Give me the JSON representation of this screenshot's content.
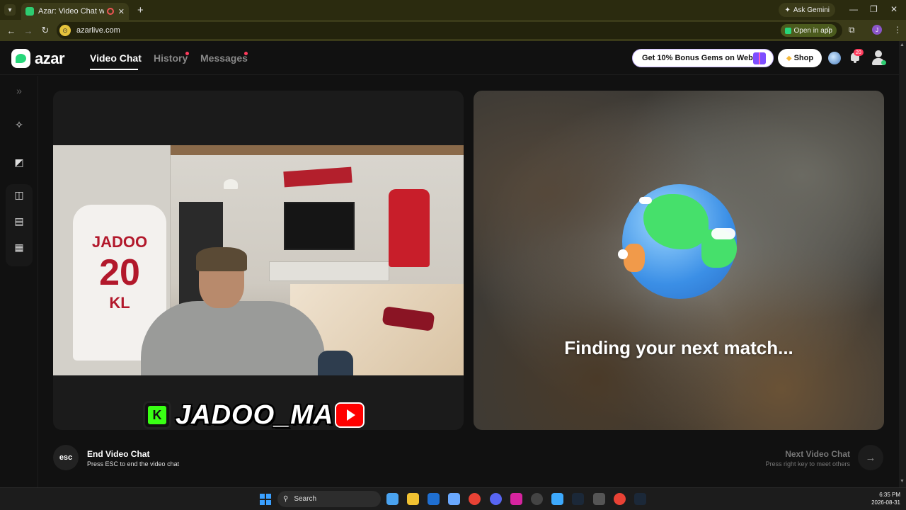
{
  "browser": {
    "tab_title": "Azar: Video Chat with New",
    "ask_gemini": "Ask Gemini",
    "url": "azarlive.com",
    "open_in_app": "Open in app",
    "profile_initial": "J"
  },
  "header": {
    "logo": "azar",
    "nav": [
      {
        "label": "Video Chat",
        "active": true
      },
      {
        "label": "History",
        "dot": true
      },
      {
        "label": "Messages",
        "dot": true
      }
    ],
    "bonus_label": "Get 10% Bonus Gems on Web!",
    "shop_label": "Shop",
    "notifications_count": "20"
  },
  "left_panel": {
    "shirt_name": "JADOO",
    "shirt_number": "20",
    "shirt_initials": "KL",
    "overlay_k": "K",
    "overlay_name": "JADOO_MA"
  },
  "right_panel": {
    "status_text": "Finding your next match..."
  },
  "controls": {
    "esc_label": "esc",
    "end_title": "End Video Chat",
    "end_subtitle": "Press ESC to end the video chat",
    "next_title": "Next Video Chat",
    "next_subtitle": "Press right key to meet others"
  },
  "taskbar": {
    "search_label": "Search",
    "time": "6:35 PM",
    "date": "2026-08-31"
  },
  "colors": {
    "brand_green": "#27d67a",
    "notification_red": "#ff3b5c",
    "bonus_purple": "#7d4dff"
  }
}
